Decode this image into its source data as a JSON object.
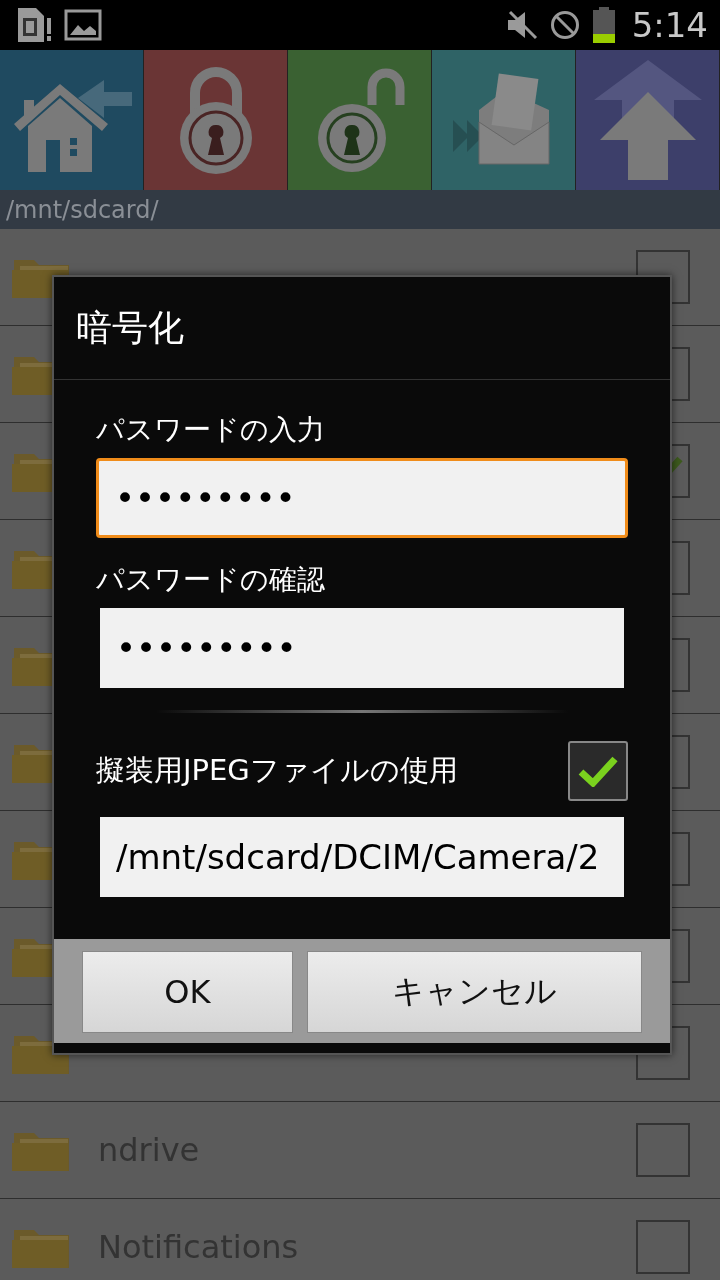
{
  "status_bar": {
    "time": "5:14"
  },
  "toolbar": [
    {
      "kind": "home",
      "color": "#1f4a60"
    },
    {
      "kind": "lock",
      "color": "#6a3535"
    },
    {
      "kind": "unlock",
      "color": "#3a6132"
    },
    {
      "kind": "mail",
      "color": "#2f6366"
    },
    {
      "kind": "up",
      "color": "#3d3f6a"
    }
  ],
  "path": "/mnt/sdcard/",
  "files": [
    {
      "checked": false
    },
    {
      "checked": false
    },
    {
      "checked": true
    },
    {
      "checked": false
    },
    {
      "checked": false
    },
    {
      "checked": false
    },
    {
      "checked": false
    },
    {
      "checked": false
    },
    {
      "checked": false
    },
    {
      "name": "ndrive",
      "checked": false
    },
    {
      "name": "Notifications",
      "checked": false
    }
  ],
  "dialog": {
    "title": "暗号化",
    "password_label": "パスワードの入力",
    "password": {
      "value": "•••••••••",
      "focused": true
    },
    "confirm_label": "パスワードの確認",
    "confirm": {
      "value": "•••••••••",
      "focused": false
    },
    "jpeg_option": {
      "label": "擬装用JPEGファイルの使用",
      "checked": true
    },
    "jpeg_path": {
      "value": "/mnt/sdcard/DCIM/Camera/2"
    },
    "buttons": [
      "OK",
      "キャンセル"
    ]
  }
}
